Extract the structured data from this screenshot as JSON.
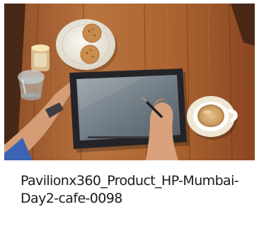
{
  "card": {
    "caption": "Pavilionx360_Product_HP-Mumbai-Day2-cafe-0098"
  },
  "photo": {
    "colors": {
      "wood": "#b0693a",
      "wood_dark": "#5a2f18",
      "tablet": "#2a2a2e",
      "screen": "#7b848c",
      "skin": "#d9a27c",
      "sleeve": "#3d63b4"
    }
  }
}
